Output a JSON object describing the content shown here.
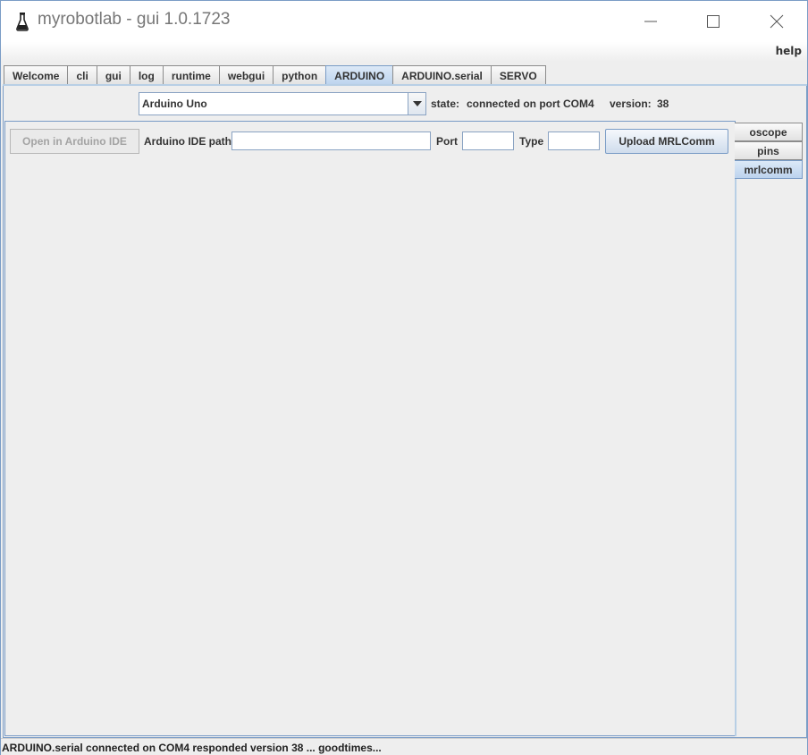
{
  "window": {
    "title": "myrobotlab - gui 1.0.1723",
    "icon": "flask-icon",
    "controls": [
      "minimize-icon",
      "maximize-icon",
      "close-icon"
    ]
  },
  "menu": {
    "help": "help"
  },
  "tabs": [
    {
      "label": "Welcome"
    },
    {
      "label": "cli"
    },
    {
      "label": "gui"
    },
    {
      "label": "log"
    },
    {
      "label": "runtime"
    },
    {
      "label": "webgui"
    },
    {
      "label": "python"
    },
    {
      "label": "ARDUINO",
      "active": true
    },
    {
      "label": "ARDUINO.serial"
    },
    {
      "label": "SERVO"
    }
  ],
  "board": {
    "selected": "Arduino Uno",
    "state_label": "state:",
    "state_value": "connected on port COM4",
    "version_label": "version:",
    "version_value": "38"
  },
  "mrlcomm": {
    "open_ide_label": "Open in Arduino IDE",
    "ide_path_label": "Arduino IDE path",
    "ide_path_value": "",
    "port_label": "Port",
    "port_value": "",
    "type_label": "Type",
    "type_value": "",
    "upload_label": "Upload MRLComm"
  },
  "side_tabs": [
    {
      "label": "oscope"
    },
    {
      "label": "pins"
    },
    {
      "label": "mrlcomm",
      "active": true
    }
  ],
  "status": "ARDUINO.serial connected on COM4 responded version 38 ... goodtimes...",
  "colors": {
    "accent": "#bcd3ee",
    "border": "#7a9cc6",
    "background": "#eeeeee"
  }
}
